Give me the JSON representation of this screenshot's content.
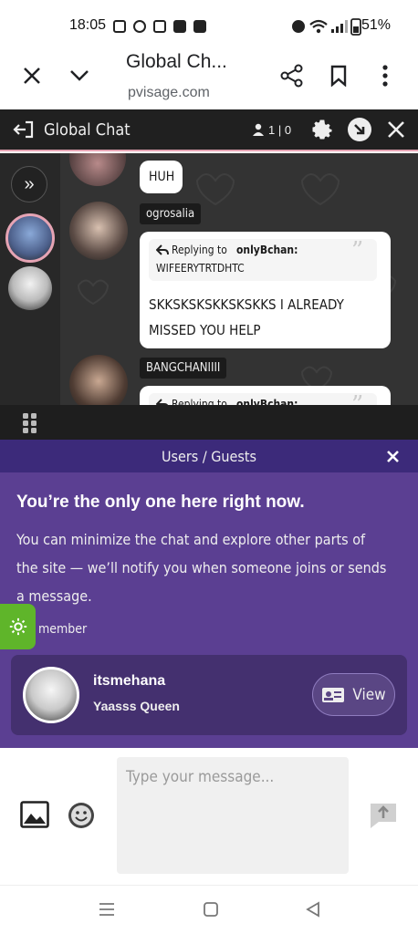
{
  "status_bar": {
    "time": "18:05",
    "battery": "51%"
  },
  "browser": {
    "title": "Global Ch...",
    "url": "pvisage.com"
  },
  "chat_header": {
    "title": "Global Chat",
    "online_count": "1 | 0"
  },
  "messages": [
    {
      "text": "HUH"
    },
    {
      "username": "ogrosalia",
      "reply_to_prefix": "Replying to",
      "reply_to_user": "onlyBchan:",
      "reply_snippet": "WIFEERYTRTDHTC",
      "text": "SKKSKSKSKKSKSKKS I ALREADY MISSED YOU HELP"
    },
    {
      "username": "BANGCHANIIII",
      "reply_to_prefix": "Replying to",
      "reply_to_user": "onlyBchan:"
    }
  ],
  "users_panel": {
    "title": "Users / Guests",
    "heading": "You’re the only one here right now.",
    "body": "You can minimize the chat and explore other parts of the site — we’ll notify you when someone joins or sends a message.",
    "member_label": "member",
    "user": {
      "name": "itsmehana",
      "status": "Yaasss Queen",
      "view_label": "View"
    }
  },
  "compose": {
    "placeholder": "Type your message..."
  },
  "colors": {
    "panel_purple": "#5b3f92",
    "header_purple": "#3c2a7a",
    "chat_dark": "#333333",
    "accent_pink": "#e6a4b4",
    "green_badge": "#5fb52a"
  }
}
